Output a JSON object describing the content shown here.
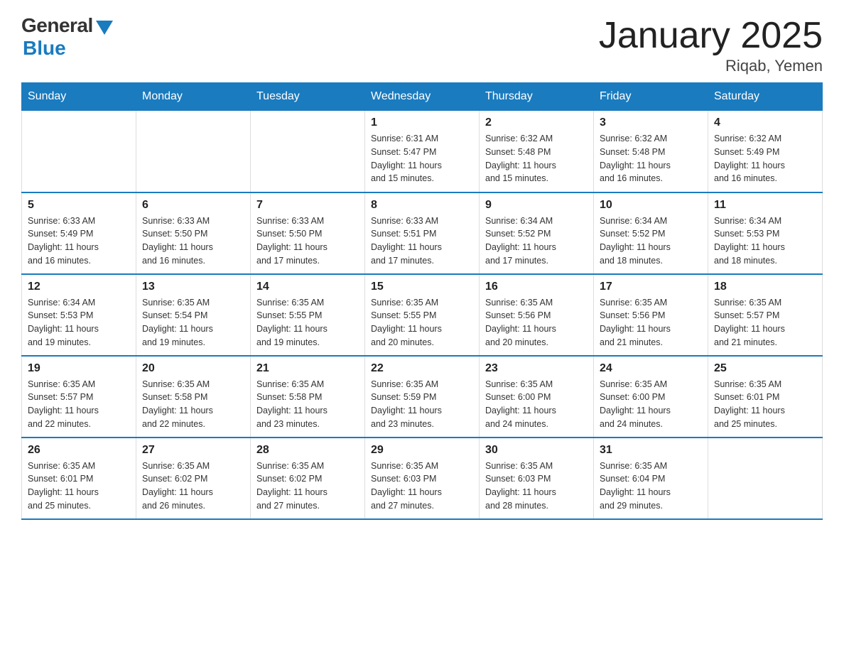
{
  "header": {
    "logo": {
      "general": "General",
      "blue": "Blue"
    },
    "title": "January 2025",
    "location": "Riqab, Yemen"
  },
  "calendar": {
    "headers": [
      "Sunday",
      "Monday",
      "Tuesday",
      "Wednesday",
      "Thursday",
      "Friday",
      "Saturday"
    ],
    "weeks": [
      [
        {
          "day": "",
          "info": ""
        },
        {
          "day": "",
          "info": ""
        },
        {
          "day": "",
          "info": ""
        },
        {
          "day": "1",
          "info": "Sunrise: 6:31 AM\nSunset: 5:47 PM\nDaylight: 11 hours\nand 15 minutes."
        },
        {
          "day": "2",
          "info": "Sunrise: 6:32 AM\nSunset: 5:48 PM\nDaylight: 11 hours\nand 15 minutes."
        },
        {
          "day": "3",
          "info": "Sunrise: 6:32 AM\nSunset: 5:48 PM\nDaylight: 11 hours\nand 16 minutes."
        },
        {
          "day": "4",
          "info": "Sunrise: 6:32 AM\nSunset: 5:49 PM\nDaylight: 11 hours\nand 16 minutes."
        }
      ],
      [
        {
          "day": "5",
          "info": "Sunrise: 6:33 AM\nSunset: 5:49 PM\nDaylight: 11 hours\nand 16 minutes."
        },
        {
          "day": "6",
          "info": "Sunrise: 6:33 AM\nSunset: 5:50 PM\nDaylight: 11 hours\nand 16 minutes."
        },
        {
          "day": "7",
          "info": "Sunrise: 6:33 AM\nSunset: 5:50 PM\nDaylight: 11 hours\nand 17 minutes."
        },
        {
          "day": "8",
          "info": "Sunrise: 6:33 AM\nSunset: 5:51 PM\nDaylight: 11 hours\nand 17 minutes."
        },
        {
          "day": "9",
          "info": "Sunrise: 6:34 AM\nSunset: 5:52 PM\nDaylight: 11 hours\nand 17 minutes."
        },
        {
          "day": "10",
          "info": "Sunrise: 6:34 AM\nSunset: 5:52 PM\nDaylight: 11 hours\nand 18 minutes."
        },
        {
          "day": "11",
          "info": "Sunrise: 6:34 AM\nSunset: 5:53 PM\nDaylight: 11 hours\nand 18 minutes."
        }
      ],
      [
        {
          "day": "12",
          "info": "Sunrise: 6:34 AM\nSunset: 5:53 PM\nDaylight: 11 hours\nand 19 minutes."
        },
        {
          "day": "13",
          "info": "Sunrise: 6:35 AM\nSunset: 5:54 PM\nDaylight: 11 hours\nand 19 minutes."
        },
        {
          "day": "14",
          "info": "Sunrise: 6:35 AM\nSunset: 5:55 PM\nDaylight: 11 hours\nand 19 minutes."
        },
        {
          "day": "15",
          "info": "Sunrise: 6:35 AM\nSunset: 5:55 PM\nDaylight: 11 hours\nand 20 minutes."
        },
        {
          "day": "16",
          "info": "Sunrise: 6:35 AM\nSunset: 5:56 PM\nDaylight: 11 hours\nand 20 minutes."
        },
        {
          "day": "17",
          "info": "Sunrise: 6:35 AM\nSunset: 5:56 PM\nDaylight: 11 hours\nand 21 minutes."
        },
        {
          "day": "18",
          "info": "Sunrise: 6:35 AM\nSunset: 5:57 PM\nDaylight: 11 hours\nand 21 minutes."
        }
      ],
      [
        {
          "day": "19",
          "info": "Sunrise: 6:35 AM\nSunset: 5:57 PM\nDaylight: 11 hours\nand 22 minutes."
        },
        {
          "day": "20",
          "info": "Sunrise: 6:35 AM\nSunset: 5:58 PM\nDaylight: 11 hours\nand 22 minutes."
        },
        {
          "day": "21",
          "info": "Sunrise: 6:35 AM\nSunset: 5:58 PM\nDaylight: 11 hours\nand 23 minutes."
        },
        {
          "day": "22",
          "info": "Sunrise: 6:35 AM\nSunset: 5:59 PM\nDaylight: 11 hours\nand 23 minutes."
        },
        {
          "day": "23",
          "info": "Sunrise: 6:35 AM\nSunset: 6:00 PM\nDaylight: 11 hours\nand 24 minutes."
        },
        {
          "day": "24",
          "info": "Sunrise: 6:35 AM\nSunset: 6:00 PM\nDaylight: 11 hours\nand 24 minutes."
        },
        {
          "day": "25",
          "info": "Sunrise: 6:35 AM\nSunset: 6:01 PM\nDaylight: 11 hours\nand 25 minutes."
        }
      ],
      [
        {
          "day": "26",
          "info": "Sunrise: 6:35 AM\nSunset: 6:01 PM\nDaylight: 11 hours\nand 25 minutes."
        },
        {
          "day": "27",
          "info": "Sunrise: 6:35 AM\nSunset: 6:02 PM\nDaylight: 11 hours\nand 26 minutes."
        },
        {
          "day": "28",
          "info": "Sunrise: 6:35 AM\nSunset: 6:02 PM\nDaylight: 11 hours\nand 27 minutes."
        },
        {
          "day": "29",
          "info": "Sunrise: 6:35 AM\nSunset: 6:03 PM\nDaylight: 11 hours\nand 27 minutes."
        },
        {
          "day": "30",
          "info": "Sunrise: 6:35 AM\nSunset: 6:03 PM\nDaylight: 11 hours\nand 28 minutes."
        },
        {
          "day": "31",
          "info": "Sunrise: 6:35 AM\nSunset: 6:04 PM\nDaylight: 11 hours\nand 29 minutes."
        },
        {
          "day": "",
          "info": ""
        }
      ]
    ]
  }
}
